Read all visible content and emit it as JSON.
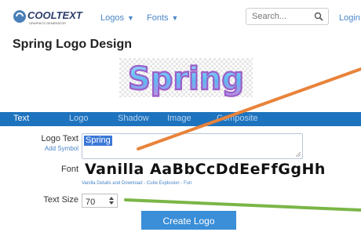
{
  "header": {
    "logo_text": "COOLTEXT",
    "logo_tagline": "GRAPHICS GENERATOR",
    "nav": [
      {
        "label": "Logos",
        "caret": "▼"
      },
      {
        "label": "Fonts",
        "caret": "▼"
      }
    ],
    "search": {
      "placeholder": "Search..."
    },
    "login_label": "Login"
  },
  "page": {
    "title": "Spring Logo Design",
    "preview_text": "Spring"
  },
  "tabs": [
    "Text",
    "Logo",
    "Shadow",
    "Image",
    "Composite"
  ],
  "active_tab": "Text",
  "form": {
    "logo_text_label": "Logo Text",
    "add_symbol_label": "Add Symbol",
    "logo_text_value": "Spring",
    "font_label": "Font",
    "font_preview": "Vanilla AaBbCcDdEeFfGgHh",
    "font_links": "Vanilla Details and Download - Cutie Explosion - Fun",
    "text_size_label": "Text Size",
    "text_size_value": "70",
    "create_button": "Create Logo"
  },
  "colors": {
    "tab_bar": "#1e73be",
    "link": "#4a86c8",
    "button": "#3b8ed8",
    "arrow_orange": "#e8833a",
    "arrow_green": "#7ab648"
  },
  "icons": [
    "cooltext-logo-icon",
    "search-icon",
    "resize-grip-icon",
    "spinner-icon"
  ]
}
